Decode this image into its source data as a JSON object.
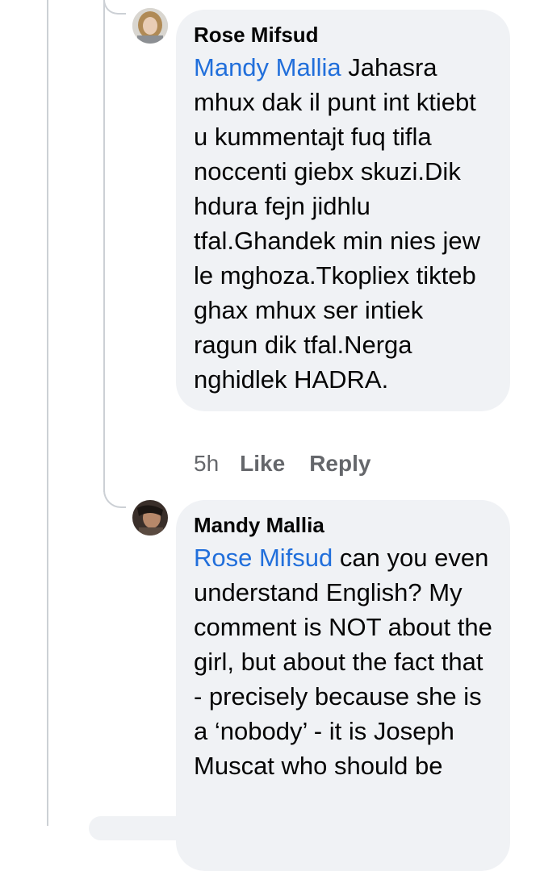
{
  "comments": [
    {
      "author": "Rose Mifsud",
      "mention": "Mandy Mallia",
      "text": " Jahasra mhux dak il punt int ktiebt u kummentajt fuq tifla noccenti giebx skuzi.Dik hdura fejn jidhlu tfal.Ghandek min nies jew le mghoza.Tkopliex tikteb ghax mhux ser intiek ragun dik tfal.Nerga nghidlek HADRA.",
      "time": "5h",
      "like_label": "Like",
      "reply_label": "Reply"
    },
    {
      "author": "Mandy Mallia",
      "mention": "Rose Mifsud",
      "text": " can you even understand English? My comment is NOT about the girl, but about the fact that - precisely because she is a ‘nobody’ - it is Joseph Muscat who should be"
    }
  ],
  "colors": {
    "mention": "#216fdb",
    "bubble_bg": "#f0f2f5",
    "meta_text": "#65676b",
    "thread_line": "#ccd0d5"
  }
}
